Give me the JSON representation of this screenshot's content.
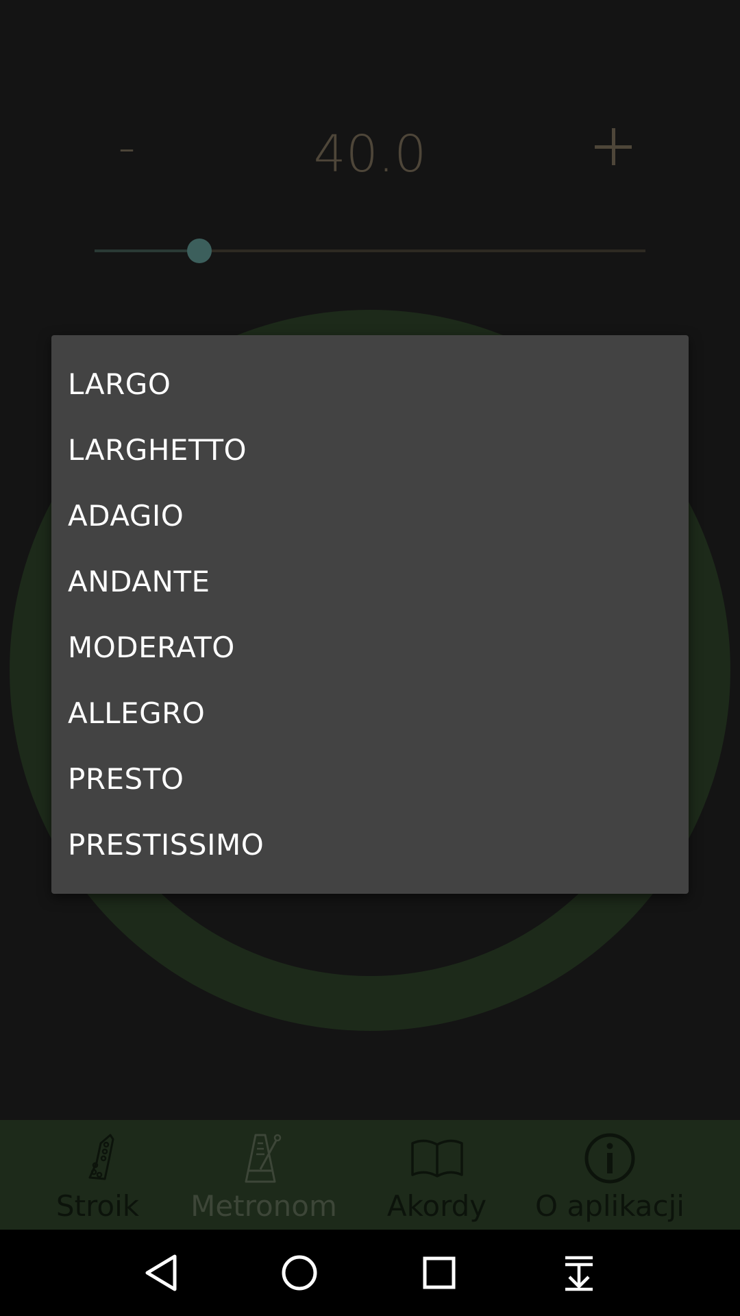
{
  "tempo": {
    "minus_label": "-",
    "value": "40.0",
    "slider_level": 0.19
  },
  "menu": {
    "items": [
      "LARGO",
      "LARGHETTO",
      "ADAGIO",
      "ANDANTE",
      "MODERATO",
      "ALLEGRO",
      "PRESTO",
      "PRESTISSIMO"
    ]
  },
  "tabs": [
    {
      "label": "Stroik",
      "icon": "guitar-headstock-icon"
    },
    {
      "label": "Metronom",
      "icon": "metronome-icon"
    },
    {
      "label": "Akordy",
      "icon": "open-book-icon"
    },
    {
      "label": "O aplikacji",
      "icon": "info-icon"
    }
  ],
  "active_tab": "Metronom",
  "navigation": {
    "buttons": [
      "back-icon",
      "home-icon",
      "recents-icon",
      "notifications-pull-icon"
    ]
  },
  "colors": {
    "background": "#141414",
    "ring": "#1d2a1a",
    "menu_bg": "#434343",
    "tabbar": "#1d2a1a",
    "slider_thumb": "#3c5f5c",
    "tempo_text": "#4e4639"
  }
}
